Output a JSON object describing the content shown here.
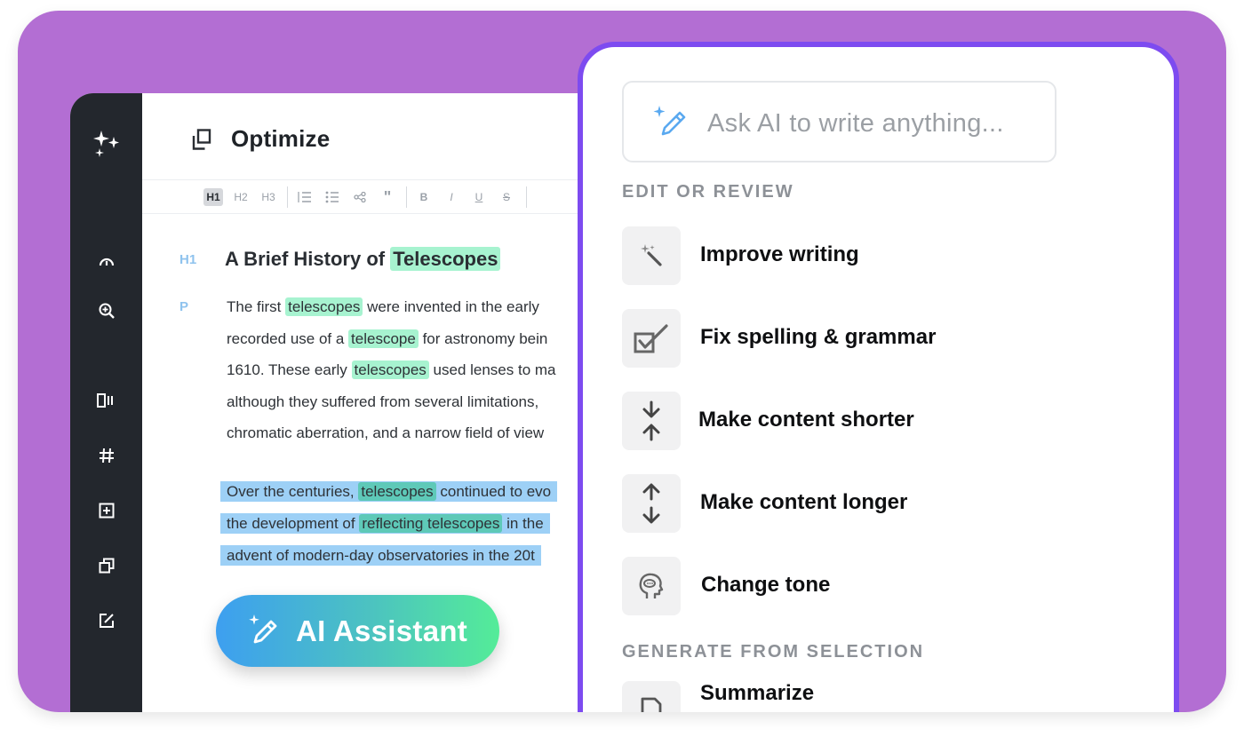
{
  "brand": {
    "background": "#b36ed3",
    "accent": "#7d4bf0",
    "highlight": "#a7f3d0"
  },
  "sidebar": {
    "icons": [
      "sparkles-icon",
      "gauge-icon",
      "zoom-in-icon",
      "columns-icon",
      "hashtag-icon",
      "add-box-icon",
      "duplicate-icon",
      "edit-box-icon"
    ]
  },
  "document": {
    "title": "Optimize",
    "toolbar": {
      "h1": "H1",
      "h2": "H2",
      "h3": "H3",
      "bold": "B",
      "italic": "I",
      "underline": "U",
      "strike": "S"
    },
    "heading_tag": "H1",
    "heading_prefix": "A Brief History of",
    "heading_highlight": "Telescopes",
    "para_tag": "P",
    "para1": {
      "l1_a": "The first",
      "l1_hl": "telescopes",
      "l1_b": "were invented in the early",
      "l2_a": "recorded use of a",
      "l2_hl": "telescope",
      "l2_b": "for astronomy bein",
      "l3_a": "1610. These early",
      "l3_hl": "telescopes",
      "l3_b": "used lenses to ma",
      "l4": "although they suffered from several limitations,",
      "l5": "chromatic aberration, and a narrow field of view"
    },
    "para2": {
      "l1_a": "Over the centuries,",
      "l1_hl": "telescopes",
      "l1_b": "continued to evo",
      "l2_a": "the development of",
      "l2_hl": "reflecting telescopes",
      "l2_b": "in the",
      "l3": "advent of modern-day observatories in the 20t"
    }
  },
  "ai_button": {
    "label": "AI Assistant"
  },
  "ai_panel": {
    "placeholder": "Ask AI to write anything...",
    "section_edit": "EDIT OR REVIEW",
    "items": [
      {
        "label": "Improve writing",
        "icon": "magic-wand-icon"
      },
      {
        "label": "Fix spelling & grammar",
        "icon": "checkbox-check-icon"
      },
      {
        "label": "Make content shorter",
        "icon": "arrows-in-icon"
      },
      {
        "label": "Make content longer",
        "icon": "arrows-out-icon"
      },
      {
        "label": "Change tone",
        "icon": "head-speech-icon"
      }
    ],
    "section_generate": "GENERATE FROM SELECTION",
    "generate_items": [
      {
        "label": "Summarize",
        "icon": "document-icon"
      }
    ]
  }
}
